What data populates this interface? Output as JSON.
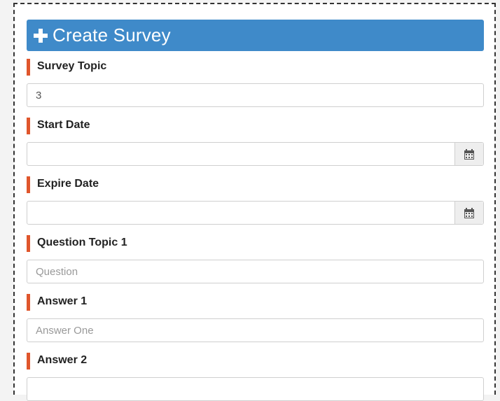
{
  "header": {
    "title": "Create Survey",
    "icon": "plus-icon"
  },
  "form": {
    "survey_topic": {
      "label": "Survey Topic",
      "value": "3",
      "placeholder": ""
    },
    "start_date": {
      "label": "Start Date",
      "value": "",
      "placeholder": "",
      "icon": "calendar-icon"
    },
    "expire_date": {
      "label": "Expire Date",
      "value": "",
      "placeholder": "",
      "icon": "calendar-icon"
    },
    "question_1": {
      "label": "Question Topic 1",
      "value": "",
      "placeholder": "Question"
    },
    "answer_1": {
      "label": "Answer 1",
      "value": "",
      "placeholder": "Answer One"
    },
    "answer_2": {
      "label": "Answer 2",
      "value": "",
      "placeholder": ""
    }
  },
  "colors": {
    "header": "#3f8ac9",
    "label_accent": "#e0562c"
  }
}
